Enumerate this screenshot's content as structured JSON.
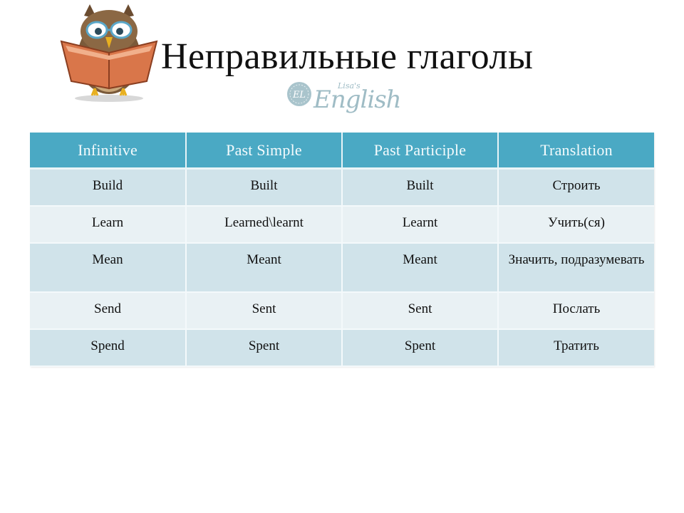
{
  "page": {
    "title": "Неправильные глаголы",
    "logo": {
      "small": "Lisa's",
      "big": "English",
      "icon": "seal-emblem-icon"
    },
    "mascot": "owl-reading-book-icon"
  },
  "colors": {
    "header_bg": "#4aa9c4",
    "row_dark": "#d0e3ea",
    "row_light": "#e9f1f4",
    "logo": "#9fbcc5"
  },
  "table": {
    "headers": [
      "Infinitive",
      "Past Simple",
      "Past Participle",
      "Translation"
    ],
    "rows": [
      [
        "Build",
        "Built",
        "Built",
        "Строить"
      ],
      [
        "Learn",
        "Learned\\learnt",
        "Learnt",
        "Учить(ся)"
      ],
      [
        "Mean",
        "Meant",
        "Meant",
        "Значить, подразумевать"
      ],
      [
        "Send",
        "Sent",
        "Sent",
        "Послать"
      ],
      [
        "Spend",
        "Spent",
        "Spent",
        "Тратить"
      ]
    ]
  }
}
